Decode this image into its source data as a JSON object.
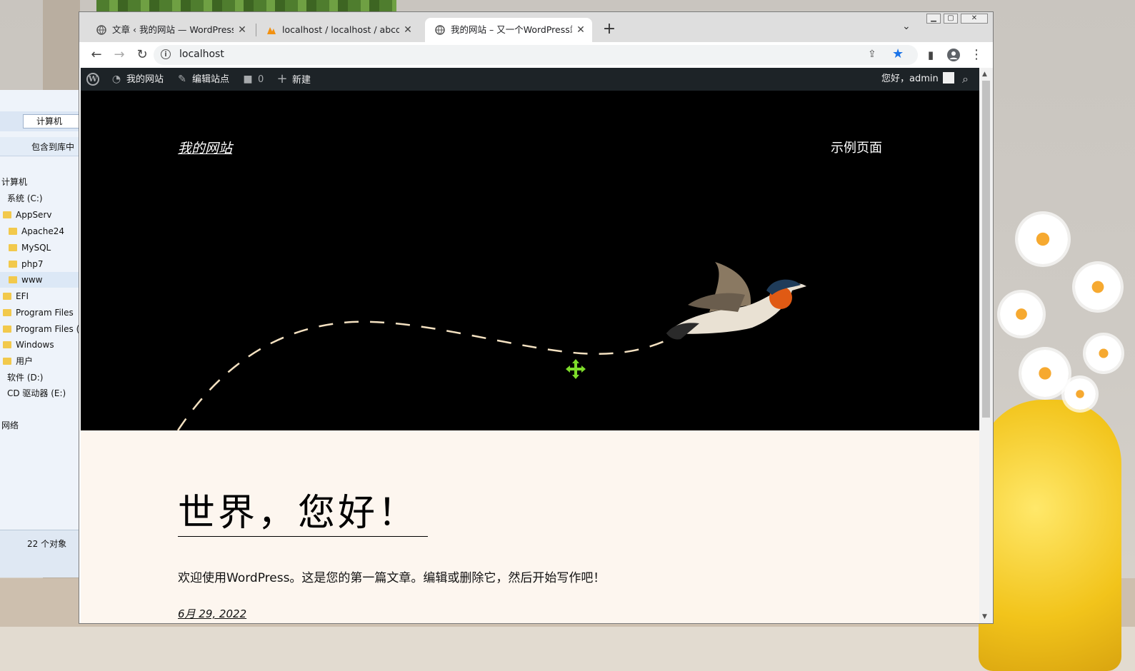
{
  "chrome": {
    "tabs": [
      {
        "title": "文章 ‹ 我的网站 — WordPress",
        "close": "✕"
      },
      {
        "title": "localhost / localhost / abcd | p",
        "close": "✕"
      },
      {
        "title": "我的网站 – 又一个WordPress站",
        "close": "✕"
      }
    ],
    "new_tab": "+",
    "address": "localhost",
    "accent": "#1a73e8"
  },
  "admin_bar": {
    "site_name": "我的网站",
    "customize": "编辑站点",
    "comments_count": "0",
    "new": "新建",
    "greeting": "您好，admin"
  },
  "site": {
    "title": "我的网站",
    "nav_item": "示例页面"
  },
  "post": {
    "title": "世界，您好！",
    "excerpt": "欢迎使用WordPress。这是您的第一篇文章。编辑或删除它，然后开始写作吧！",
    "date": "6月 29, 2022"
  },
  "explorer": {
    "breadcrumb": "计算机",
    "toolbar_button": "包含到库中",
    "tree": [
      "计算机",
      "系统 (C:)",
      "AppServ",
      "Apache24",
      "MySQL",
      "php7",
      "www",
      "EFI",
      "Program Files",
      "Program Files (",
      "Windows",
      "用户",
      "软件 (D:)",
      "CD 驱动器 (E:)",
      "网络"
    ],
    "status": "22 个对象"
  }
}
